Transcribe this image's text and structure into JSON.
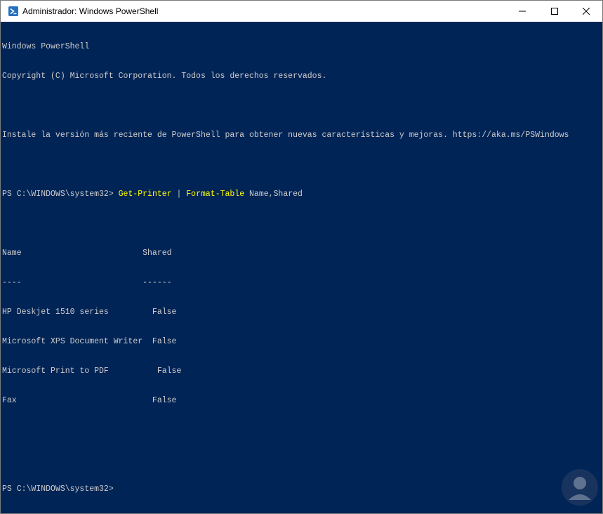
{
  "window": {
    "title": "Administrador: Windows PowerShell",
    "icon": "powershell-icon",
    "controls": {
      "minimize_icon": "minimize-icon",
      "maximize_icon": "maximize-icon",
      "close_icon": "close-icon"
    }
  },
  "colors": {
    "console_bg": "#012456",
    "console_text": "#CCCCCC",
    "command_text": "#FFFF00"
  },
  "console": {
    "banner_1": "Windows PowerShell",
    "banner_2": "Copyright (C) Microsoft Corporation. Todos los derechos reservados.",
    "banner_3": "Instale la versión más reciente de PowerShell para obtener nuevas características y mejoras. https://aka.ms/PSWindows",
    "prompt_1": "PS C:\\WINDOWS\\system32> ",
    "command_1": "Get-Printer",
    "pipe": " | ",
    "command_2": "Format-Table",
    "args": " Name,Shared",
    "table": {
      "header": "Name                         Shared",
      "separator": "----                         ------",
      "rows": [
        "HP Deskjet 1510 series         False",
        "Microsoft XPS Document Writer  False",
        "Microsoft Print to PDF          False",
        "Fax                            False"
      ]
    },
    "prompt_2": "PS C:\\WINDOWS\\system32>"
  }
}
